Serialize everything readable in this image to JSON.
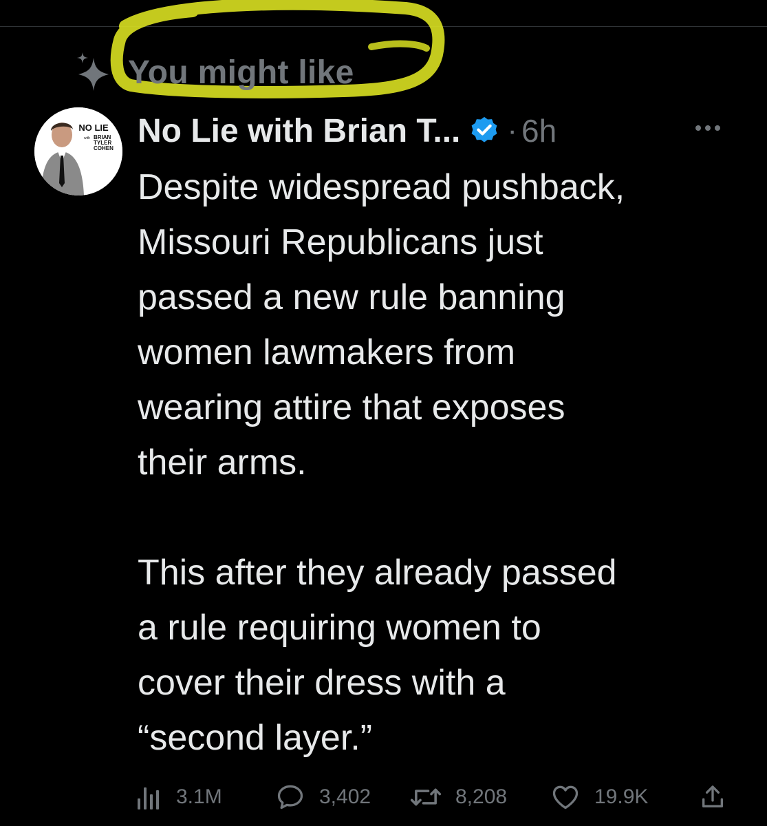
{
  "social_context": {
    "label": "You might like",
    "icon": "sparkle-icon"
  },
  "tweet": {
    "avatar": {
      "logo_line1": "NO LIE",
      "logo_with": "with",
      "logo_line2": "BRIAN",
      "logo_line3": "TYLER",
      "logo_line4": "COHEN"
    },
    "author_name": "No Lie with Brian T...",
    "dot": "·",
    "time": "6h",
    "more_label": "···",
    "text_paragraphs": [
      "Despite widespread pushback, Missouri Republicans just passed a new rule banning women lawmakers from wearing attire that exposes their arms.",
      "This after they already passed a rule requiring women to cover their dress with a “second layer.”"
    ],
    "text_lines_p1": [
      "Despite widespread pushback,",
      "Missouri Republicans just",
      "passed a new rule banning",
      "women lawmakers from",
      "wearing attire that exposes",
      "their arms."
    ],
    "text_lines_p2": [
      "This after they already passed",
      "a rule requiring women to",
      "cover their dress with a",
      "“second layer.”"
    ]
  },
  "actions": {
    "views": "3.1M",
    "replies": "3,402",
    "retweets": "8,208",
    "likes": "19.9K"
  },
  "colors": {
    "background": "#000000",
    "text": "#e7e9ea",
    "muted": "#71767b",
    "verified": "#1d9bf0",
    "highlight": "#d9e021"
  }
}
